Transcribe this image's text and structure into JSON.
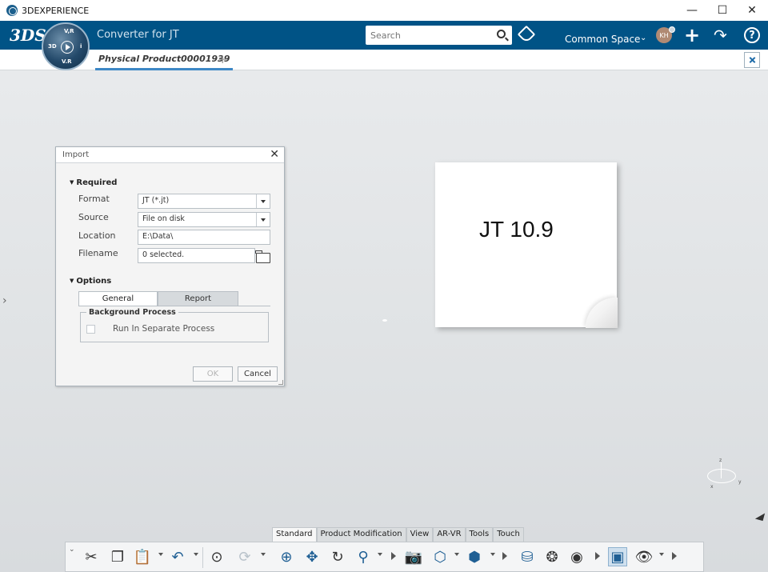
{
  "window": {
    "title": "3DEXPERIENCE",
    "minimize": "—",
    "maximize": "☐",
    "close": "✕"
  },
  "topbar": {
    "logo": "3DS",
    "compass": {
      "top": "V,R",
      "left": "3D",
      "right": "i",
      "bottom": "V.R"
    },
    "app_title": "Converter for JT",
    "search_placeholder": "Search",
    "space": "Common Space",
    "avatar_initials": "KH"
  },
  "tabs": {
    "document": "Physical Product00001939",
    "add": "+"
  },
  "dialog": {
    "title": "Import",
    "required_label": "Required",
    "format_label": "Format",
    "format_value": "JT (*.jt)",
    "source_label": "Source",
    "source_value": "File on disk",
    "location_label": "Location",
    "location_value": "E:\\Data\\",
    "filename_label": "Filename",
    "filename_value": "0 selected.",
    "options_label": "Options",
    "tab_general": "General",
    "tab_report": "Report",
    "group_label": "Background Process",
    "checkbox_label": "Run In Separate Process",
    "checkbox_checked": false,
    "ok_label": "OK",
    "cancel_label": "Cancel"
  },
  "note": {
    "text": "JT 10.9"
  },
  "axis": {
    "z": "z",
    "x": "x",
    "y": "y"
  },
  "toolbar": {
    "tabs": [
      "Standard",
      "Product Modification",
      "View",
      "AR-VR",
      "Tools",
      "Touch"
    ],
    "active_tab": "Standard"
  },
  "colors": {
    "topbar": "#005386",
    "accent": "#3d87c5",
    "canvas": "#e3e6e8"
  }
}
